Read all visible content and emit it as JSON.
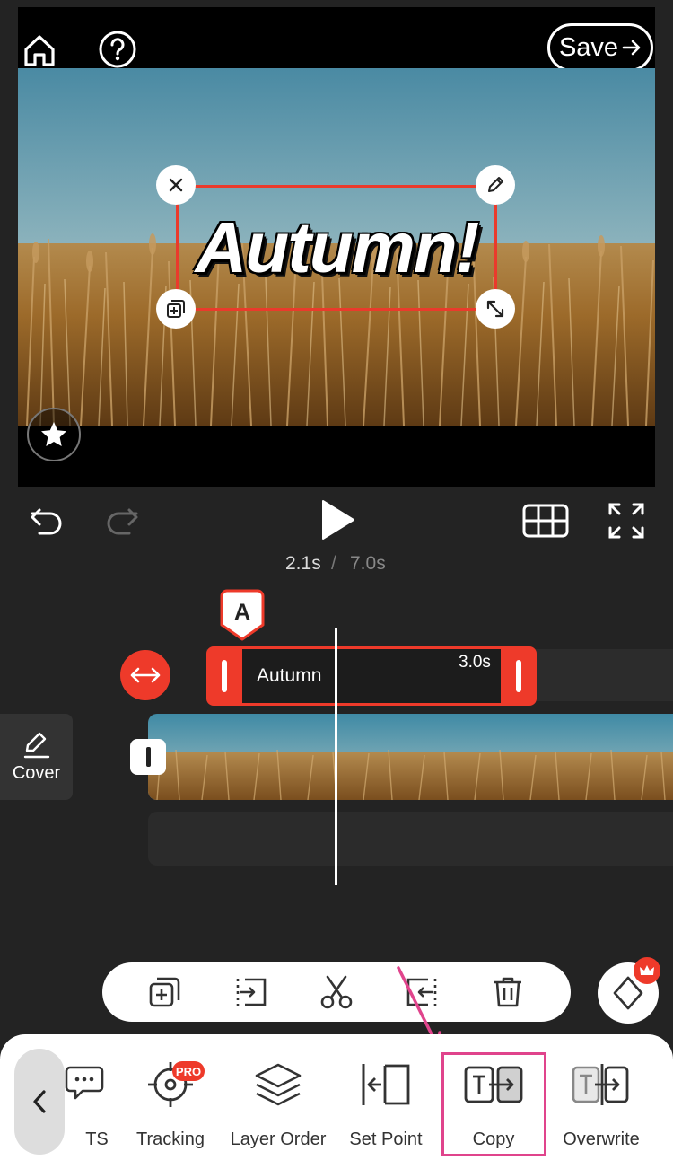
{
  "preview": {
    "save_label": "Save",
    "caption_text": "Autumn!"
  },
  "playback": {
    "current_time": "2.1s",
    "separator": "/",
    "total_time": "7.0s"
  },
  "timeline": {
    "marker_label": "A",
    "text_clip_label": "Autumn",
    "text_clip_duration": "3.0s",
    "cover_label": "Cover"
  },
  "action_bar": {
    "items": [
      "duplicate-icon",
      "split-right-icon",
      "scissors-icon",
      "split-left-icon",
      "trash-icon"
    ]
  },
  "bottom_menu": {
    "items": [
      {
        "label": "TS"
      },
      {
        "label": "Tracking",
        "badge": "PRO"
      },
      {
        "label": "Layer Order"
      },
      {
        "label": "Set Point"
      },
      {
        "label": "Copy",
        "highlighted": true
      },
      {
        "label": "Overwrite"
      }
    ]
  },
  "colors": {
    "accent": "#EE3A2A",
    "highlight": "#E0448C",
    "background": "#232323"
  }
}
